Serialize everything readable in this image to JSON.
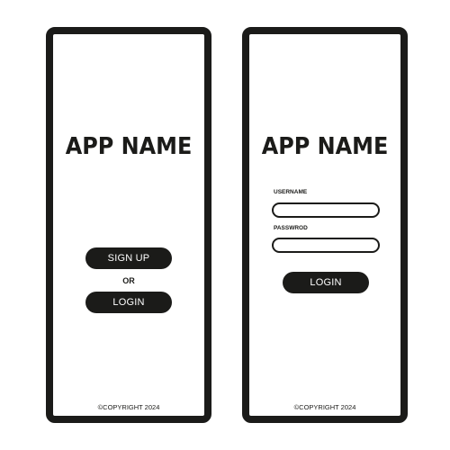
{
  "colors": {
    "frame": "#1b1b19",
    "background": "#ffffff",
    "button_text": "#ffffff"
  },
  "welcome_screen": {
    "app_name": "APP NAME",
    "signup_label": "SIGN UP",
    "or_label": "OR",
    "login_label": "LOGIN",
    "copyright": "©COPYRIGHT 2024"
  },
  "login_screen": {
    "app_name": "APP NAME",
    "username_label": "USERNAME",
    "username_value": "",
    "password_label": "PASSWROD",
    "password_value": "",
    "login_label": "LOGIN",
    "copyright": "©COPYRIGHT 2024"
  }
}
